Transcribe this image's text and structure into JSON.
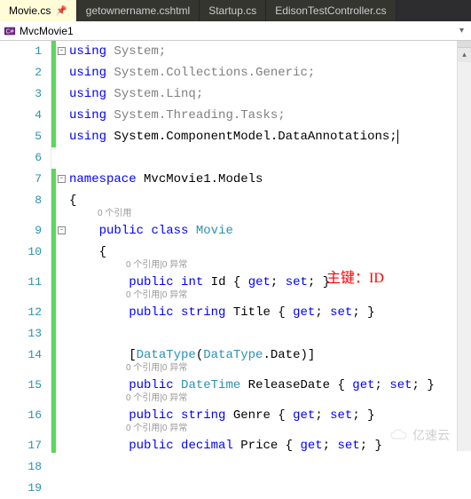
{
  "tabs": [
    {
      "label": "Movie.cs",
      "active": true,
      "pinned": true
    },
    {
      "label": "getownername.cshtml",
      "active": false
    },
    {
      "label": "Startup.cs",
      "active": false
    },
    {
      "label": "EdisonTestController.cs",
      "active": false
    }
  ],
  "navbar": {
    "context": "MvcMovie1"
  },
  "codelens": {
    "refs0": "0 个引用",
    "refs0ex": "0 个引用|0 异常"
  },
  "annotation": {
    "pk": "主键：ID"
  },
  "watermark": "亿速云",
  "code": {
    "l1": {
      "a": "using",
      "b": " System;"
    },
    "l2": {
      "a": "using",
      "b": " System.Collections.Generic;"
    },
    "l3": {
      "a": "using",
      "b": " System.Linq;"
    },
    "l4": {
      "a": "using",
      "b": " System.Threading.Tasks;"
    },
    "l5": {
      "a": "using",
      "b": " System.ComponentModel.DataAnnotations;"
    },
    "l7": {
      "a": "namespace",
      "b": " MvcMovie1.Models"
    },
    "l8": "{",
    "l9": {
      "a": "public",
      "b": "class",
      "c": "Movie"
    },
    "l10": "{",
    "l11": {
      "a": "public",
      "b": "int",
      "c": " Id ",
      "d": "get",
      "e": "set"
    },
    "l12": {
      "a": "public",
      "b": "string",
      "c": " Title ",
      "d": "get",
      "e": "set"
    },
    "l14": {
      "a": "DataType",
      "b": "DataType",
      "c": ".Date)]"
    },
    "l15": {
      "a": "public",
      "b": "DateTime",
      "c": " ReleaseDate ",
      "d": "get",
      "e": "set"
    },
    "l16": {
      "a": "public",
      "b": "string",
      "c": " Genre ",
      "d": "get",
      "e": "set"
    },
    "l17": {
      "a": "public",
      "b": "decimal",
      "c": " Price ",
      "d": "get",
      "e": "set"
    },
    "l18": "}",
    "l19": "}"
  }
}
